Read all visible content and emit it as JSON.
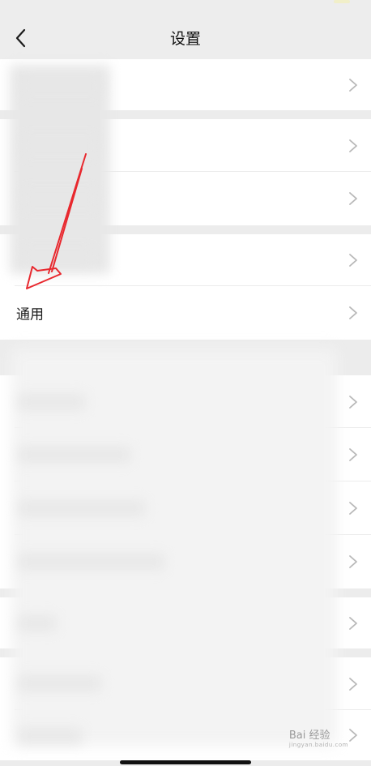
{
  "header": {
    "title": "设置",
    "back_icon": "chevron-left-icon"
  },
  "list": {
    "general_label": "通用",
    "row_chevron_icon": "chevron-right-icon"
  },
  "annotation": {
    "arrow_color": "#e8282e"
  },
  "watermark": {
    "text": "Bai 经验",
    "subtext": "jingyan.baidu.com"
  },
  "colors": {
    "background": "#ececec",
    "cell": "#ffffff",
    "chevron": "#b8b8b8"
  }
}
